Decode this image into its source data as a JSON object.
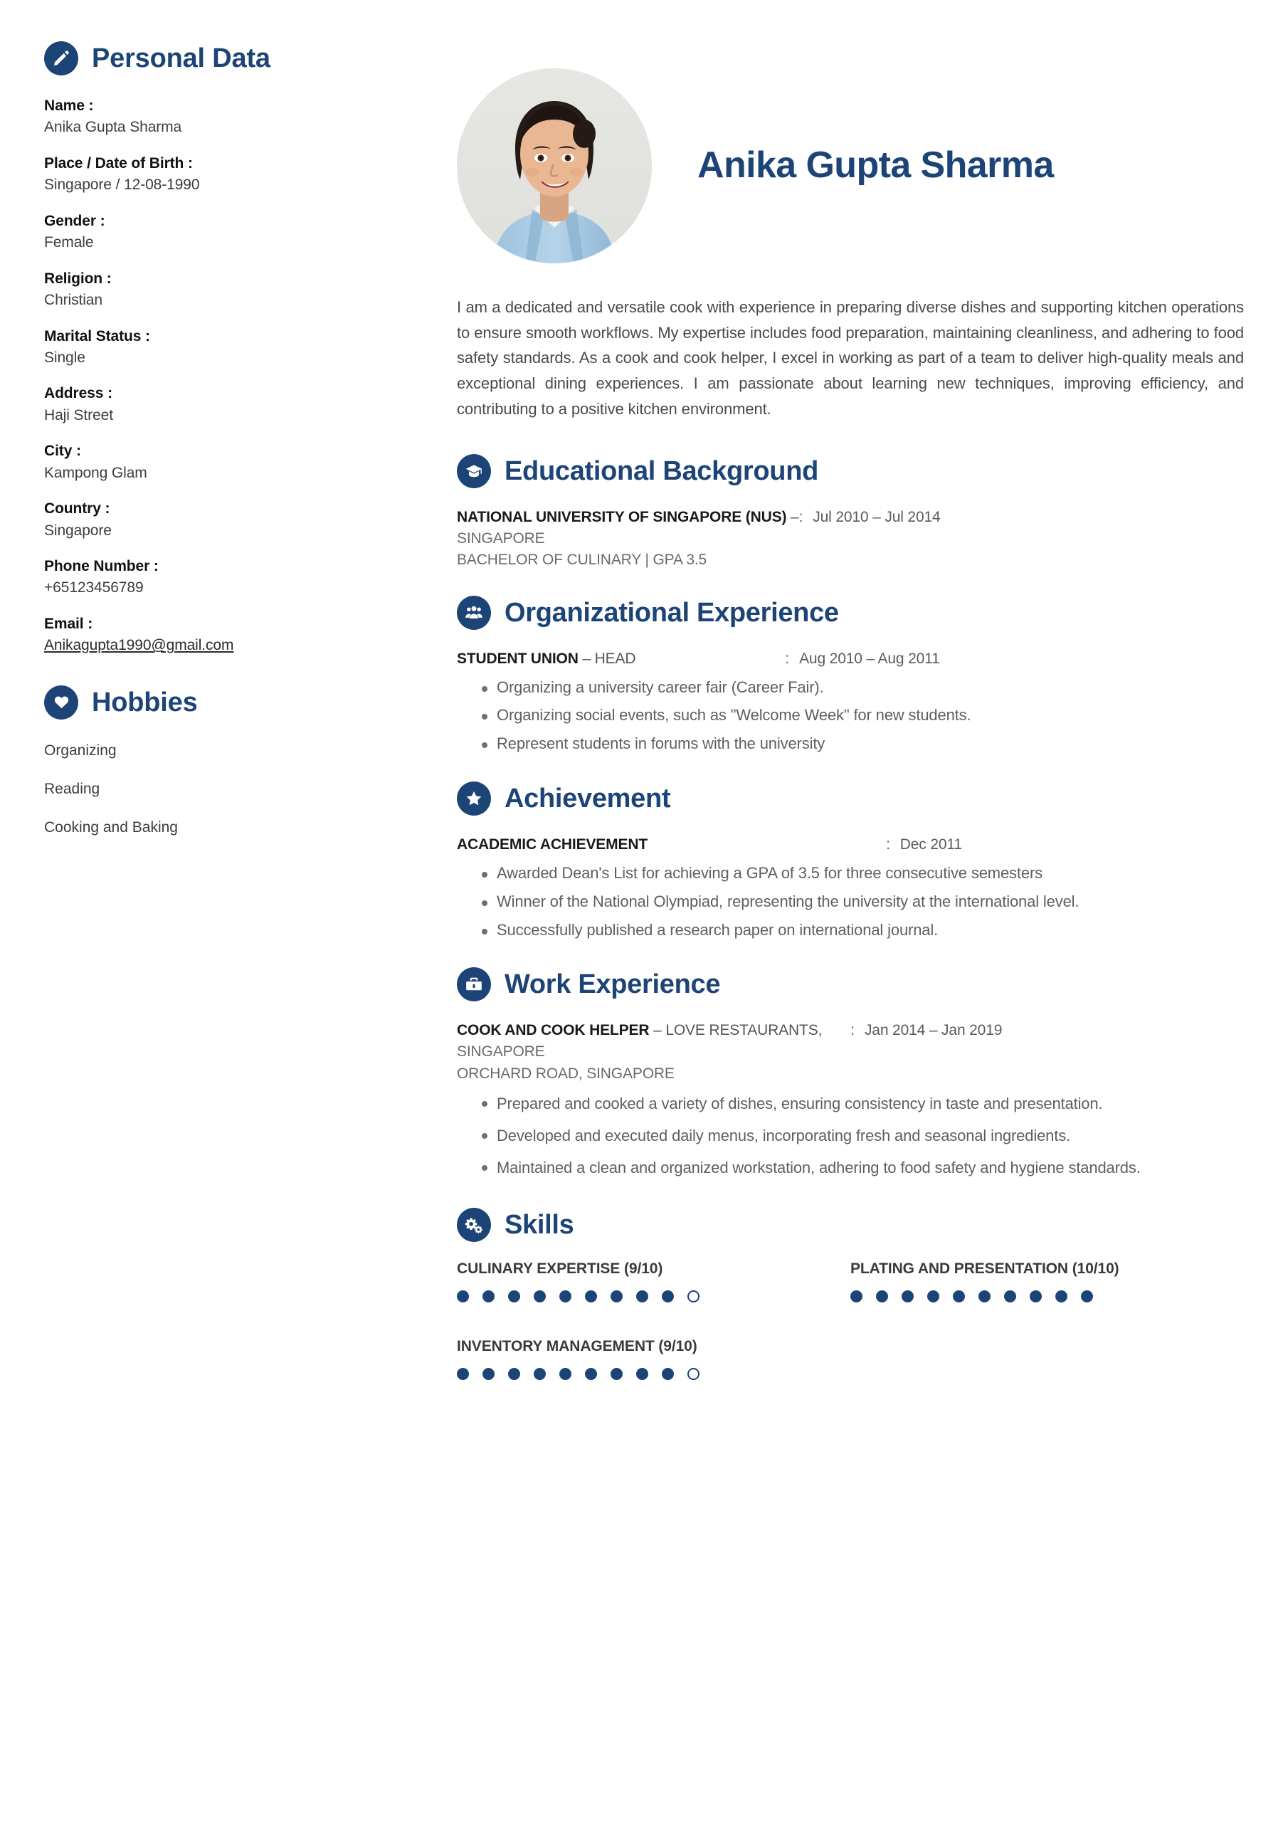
{
  "theme": {
    "accent": "#1D4477",
    "text": "#3d3d3d",
    "muted": "#6a6a6a"
  },
  "left": {
    "personal_data": {
      "heading": "Personal Data",
      "icon": "pencil-icon",
      "fields": [
        {
          "label": "Name :",
          "value": "Anika Gupta Sharma"
        },
        {
          "label": "Place / Date of Birth :",
          "value": "Singapore / 12-08-1990"
        },
        {
          "label": "Gender :",
          "value": "Female"
        },
        {
          "label": "Religion :",
          "value": "Christian"
        },
        {
          "label": "Marital Status :",
          "value": "Single"
        },
        {
          "label": "Address :",
          "value": "Haji Street"
        },
        {
          "label": "City :",
          "value": "Kampong Glam"
        },
        {
          "label": "Country :",
          "value": "Singapore"
        },
        {
          "label": "Phone Number :",
          "value": "+65123456789"
        },
        {
          "label": "Email :",
          "value": "Anikagupta1990@gmail.com",
          "link": true
        }
      ]
    },
    "hobbies": {
      "heading": "Hobbies",
      "icon": "heart-icon",
      "items": [
        "Organizing",
        "Reading",
        "Cooking and Baking"
      ]
    }
  },
  "right": {
    "hero": {
      "name": "Anika Gupta Sharma",
      "photo_alt": "profile-photo"
    },
    "summary": "I am a dedicated and versatile cook with experience in preparing diverse dishes and supporting kitchen operations to ensure smooth workflows. My expertise includes food preparation, maintaining cleanliness, and adhering to food safety standards. As a cook and cook helper, I excel in working as part of a team to deliver high-quality meals and exceptional dining experiences. I am passionate about learning new techniques, improving efficiency, and contributing to a positive kitchen environment.",
    "education": {
      "heading": "Educational Background",
      "icon": "graduation-cap-icon",
      "entries": [
        {
          "org": "NATIONAL UNIVERSITY OF SINGAPORE (NUS)",
          "dash": "–",
          "role": "",
          "date_colon": ":",
          "date": "Jul 2010 – Jul 2014",
          "sublines": [
            "SINGAPORE",
            "BACHELOR OF CULINARY | GPA 3.5"
          ],
          "bullets": []
        }
      ]
    },
    "organizational": {
      "heading": "Organizational Experience",
      "icon": "people-group-icon",
      "entries": [
        {
          "org": "STUDENT UNION",
          "dash": "–",
          "role": "HEAD",
          "date_colon": ":",
          "date": "Aug 2010 – Aug 2011",
          "sublines": [],
          "bullets": [
            "Organizing a university career fair (Career Fair).",
            "Organizing social events, such as \"Welcome Week\" for new students.",
            "Represent students in forums with the university"
          ]
        }
      ]
    },
    "achievement": {
      "heading": "Achievement",
      "icon": "star-icon",
      "entries": [
        {
          "org": "ACADEMIC ACHIEVEMENT",
          "dash": "",
          "role": "",
          "date_colon": ":",
          "date": "Dec 2011",
          "sublines": [],
          "bullets": [
            "Awarded Dean's List for achieving a GPA of 3.5 for three consecutive semesters",
            "Winner of the National Olympiad, representing the university at the international level.",
            "Successfully published a research paper on international journal."
          ]
        }
      ]
    },
    "work": {
      "heading": "Work Experience",
      "icon": "briefcase-icon",
      "entries": [
        {
          "org": "COOK AND COOK HELPER",
          "dash": "–",
          "role": "LOVE RESTAURANTS,",
          "date_colon": ":",
          "date": "Jan 2014 – Jan 2019",
          "sublines": [
            "SINGAPORE",
            "ORCHARD ROAD, SINGAPORE"
          ],
          "bullets": [
            "Prepared and cooked a variety of dishes, ensuring consistency in taste and presentation.",
            "Developed and executed daily menus, incorporating fresh and seasonal ingredients.",
            "Maintained a clean and organized workstation, adhering to food safety and hygiene standards."
          ]
        }
      ]
    },
    "skills": {
      "heading": "Skills",
      "icon": "gears-icon",
      "max": 10,
      "items": [
        {
          "label": "CULINARY EXPERTISE (9/10)",
          "value": 9
        },
        {
          "label": "PLATING AND PRESENTATION (10/10)",
          "value": 10
        },
        {
          "label": "INVENTORY MANAGEMENT (9/10)",
          "value": 9
        }
      ]
    }
  }
}
